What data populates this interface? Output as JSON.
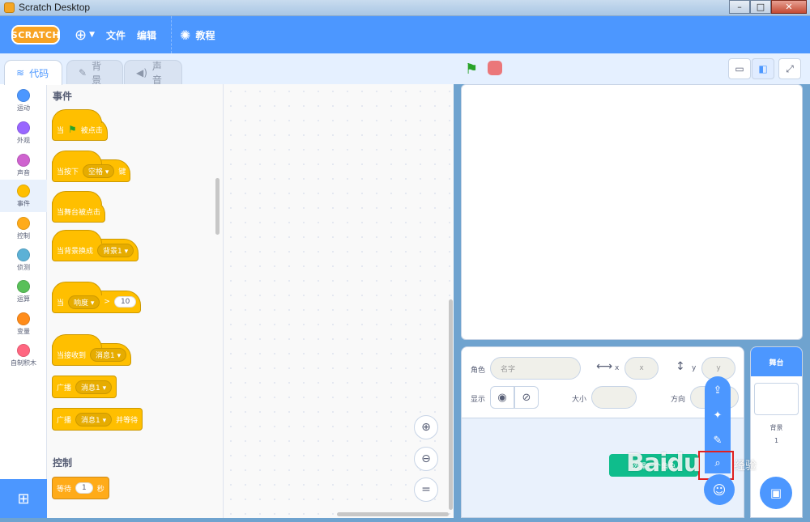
{
  "window": {
    "title": "Scratch Desktop",
    "minimize": "–",
    "maximize": "□",
    "close": "✕"
  },
  "menubar": {
    "logo": "SCRATCH",
    "file": "文件",
    "edit": "编辑",
    "tutorials": "教程"
  },
  "tabs": {
    "code": "代码",
    "backdrops": "背景",
    "sounds": "声音"
  },
  "categories": [
    {
      "label": "运动",
      "color": "#4c97ff"
    },
    {
      "label": "外观",
      "color": "#9966ff"
    },
    {
      "label": "声音",
      "color": "#cf63cf"
    },
    {
      "label": "事件",
      "color": "#ffbf00"
    },
    {
      "label": "控制",
      "color": "#ffab19"
    },
    {
      "label": "侦测",
      "color": "#5cb1d6"
    },
    {
      "label": "运算",
      "color": "#59c059"
    },
    {
      "label": "变量",
      "color": "#ff8c1a"
    },
    {
      "label": "自制积木",
      "color": "#ff6680"
    }
  ],
  "palette": {
    "events_heading": "事件",
    "control_heading": "控制",
    "when_flag_clicked": {
      "pre": "当",
      "post": "被点击"
    },
    "when_key_pressed": {
      "pre": "当按下",
      "key": "空格 ▾",
      "post": "键"
    },
    "when_stage_clicked": "当舞台被点击",
    "when_backdrop_switches": {
      "pre": "当背景换成",
      "value": "背景1 ▾"
    },
    "when_greater_than": {
      "pre": "当",
      "sensor": "响度 ▾",
      "op": ">",
      "value": "10"
    },
    "when_receive": {
      "pre": "当接收到",
      "value": "消息1 ▾"
    },
    "broadcast": {
      "pre": "广播",
      "value": "消息1 ▾"
    },
    "broadcast_wait": {
      "pre": "广播",
      "value": "消息1 ▾",
      "post": "并等待"
    },
    "wait": {
      "pre": "等待",
      "value": "1",
      "post": "秒"
    }
  },
  "sprite_info": {
    "sprite_label": "角色",
    "name_placeholder": "名字",
    "x_label": "x",
    "x_placeholder": "x",
    "y_label": "y",
    "y_placeholder": "y",
    "show_label": "显示",
    "size_label": "大小",
    "direction_label": "方向"
  },
  "stage_pane": {
    "header": "舞台",
    "backdrops_label": "背景",
    "backdrops_count": "1"
  },
  "tooltip": {
    "text": "选择一个角色"
  },
  "watermark": {
    "text": "Baidu",
    "sub": "经验"
  }
}
